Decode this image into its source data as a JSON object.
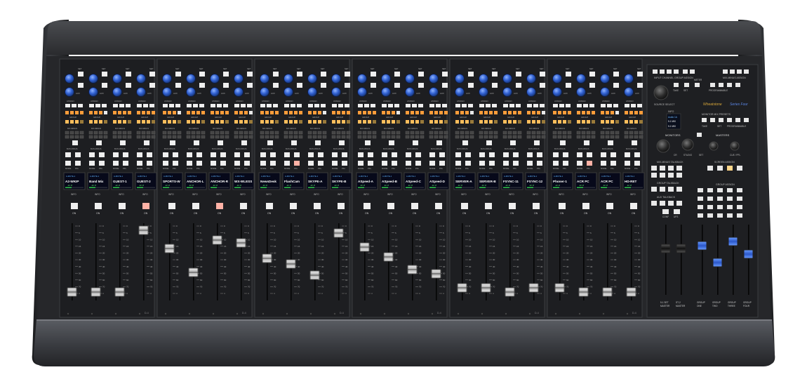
{
  "console": {
    "brand": "Wheatstone",
    "model": "Series Four",
    "module_tag": "D-4"
  },
  "channel_labels": {
    "set": "SET",
    "aux": "AUX",
    "assign": "ASSIGN",
    "group": "GROUP",
    "mix_minus": "MX-MINUS",
    "bus_minus": "BUS MINUS",
    "mode": "MODE",
    "pfl": "PFL",
    "info": "INFO",
    "on": "ON"
  },
  "channels": [
    {
      "name": "A2-WKIP",
      "src": "A-MUTE-1",
      "meter": "-12  -8"
    },
    {
      "name": "Band Mix",
      "src": "A-MUTE-1",
      "meter": "-12  -8"
    },
    {
      "name": "GUEST-1",
      "src": "A-MUTE-1",
      "meter": "-12  -8"
    },
    {
      "name": "GUEST-2",
      "src": "A-MUTE-1",
      "meter": "-12  -8"
    },
    {
      "name": "SPORTS-W",
      "src": "A-MUTE-1",
      "meter": "-12  -8"
    },
    {
      "name": "ANCHOR-L",
      "src": "A-MUTE-1",
      "meter": "-12  -8"
    },
    {
      "name": "ANCHOR-R",
      "src": "A-MUTE-1",
      "meter": "-12  -8"
    },
    {
      "name": "WX-WLESS",
      "src": "A-MUTE-1",
      "meter": "-12  -8"
    },
    {
      "name": "NewsDesk",
      "src": "A-MUTE-1",
      "meter": "-12  -8"
    },
    {
      "name": "FlashCam",
      "src": "A-MUTE-1",
      "meter": "-12  -8"
    },
    {
      "name": "SKYPE-A",
      "src": "A-MUTE-1",
      "meter": "-12  -8"
    },
    {
      "name": "SKYPE-B",
      "src": "A-MUTE-1",
      "meter": "-12  -8"
    },
    {
      "name": "ASpeed-A",
      "src": "A-MUTE-1",
      "meter": "-12  -8"
    },
    {
      "name": "ASpeed-B",
      "src": "A-MUTE-1",
      "meter": "-12  -8"
    },
    {
      "name": "ASpeed-C",
      "src": "A-MUTE-1",
      "meter": "-12  -8"
    },
    {
      "name": "ASpeed-D",
      "src": "A-MUTE-1",
      "meter": "-12  -8"
    },
    {
      "name": "SERVER-A",
      "src": "A-MUTE-1",
      "meter": "-12  -8"
    },
    {
      "name": "SERVER-B",
      "src": "A-MUTE-1",
      "meter": "-12  -8"
    },
    {
      "name": "FSYNC-11",
      "src": "A-MUTE-1",
      "meter": "-12  -8"
    },
    {
      "name": "FSYNC-12",
      "src": "A-MUTE-1",
      "meter": "-12  -8"
    },
    {
      "name": "Phoner-1",
      "src": "A-MUTE-1",
      "meter": "-12  -8"
    },
    {
      "name": "ACR PC",
      "src": "A-MUTE-1",
      "meter": "-12  -8"
    },
    {
      "name": "ACR PC",
      "src": "A-MUTE-1",
      "meter": "-12  -8"
    },
    {
      "name": "HD-RET",
      "src": "A-MUTE-1",
      "meter": "-12  -8"
    }
  ],
  "fader_scale": [
    "0",
    "5",
    "10",
    "15",
    "20",
    "30",
    "40",
    "50",
    "60",
    "70",
    "∞"
  ],
  "master_section": {
    "input_channel_group_assign": "INPUT CHANNEL GROUP ASSIGN",
    "mix_minus_assign": "MIX-MINUS ASSIGN",
    "take": "TAKE",
    "set": "SET",
    "meter": "METER",
    "programmable": "PROGRAMMABLE",
    "source_select": "SOURCE SELECT",
    "info": "INFO",
    "info_display": [
      "Audio 1A",
      "5.1 MIX",
      "5.1 MIX"
    ],
    "monitor_mix_presets": "MONITOR MIX PRESETS",
    "take_btn": "TAKE",
    "set_btn": "SET",
    "programmable_btn": "PROGRAMMABLE",
    "monitors": "MONITORS",
    "masters": "MASTERS",
    "cr": "CR",
    "studio": "STUDIO",
    "set_knob": "SET",
    "cue_pfl": "CUE / PFL",
    "mix_minus_talkback": "MIX-MINUS TALKBACK",
    "screen_assign": "SCREEN ASSIGN",
    "group_talkback": "GROUP TALKBACK",
    "aux_talkback": "AUX TALKBACK",
    "group_assign": "GROUP ASSIGN",
    "conf": "CONF",
    "ufs": "UFS",
    "master_labels": [
      {
        "a": "5.1 SET",
        "b": "MASTER"
      },
      {
        "a": "ST-2",
        "b": "MASTER"
      },
      {
        "a": "GROUP",
        "b": "ONE"
      },
      {
        "a": "GROUP",
        "b": "TWO"
      },
      {
        "a": "GROUP",
        "b": "THREE"
      },
      {
        "a": "GROUP",
        "b": "FOUR"
      }
    ]
  }
}
